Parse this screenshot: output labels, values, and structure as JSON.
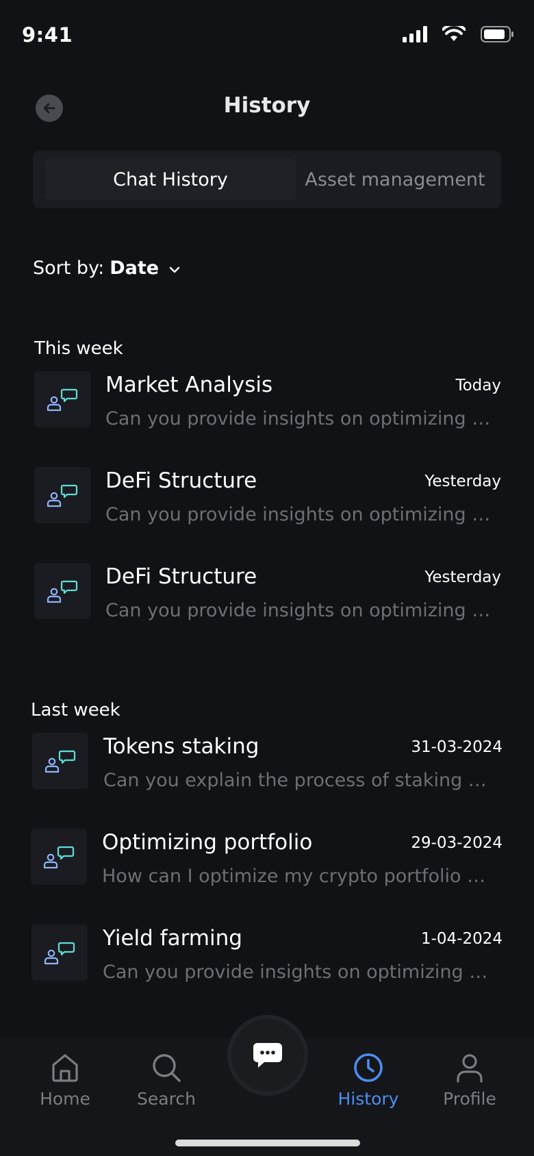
{
  "status_bar": {
    "time": "9:41"
  },
  "header": {
    "title": "History"
  },
  "tabs": [
    {
      "label": "Chat History",
      "active": true
    },
    {
      "label": "Asset management",
      "active": false
    }
  ],
  "sort": {
    "prefix": "Sort by:",
    "value": "Date"
  },
  "sections": [
    {
      "title": "This week",
      "items": [
        {
          "title": "Market Analysis",
          "date": "Today",
          "preview": "Can you provide insights on optimizing my portfolio?"
        },
        {
          "title": "DeFi Structure",
          "date": "Yesterday",
          "preview": "Can you provide insights on optimizing my portfolio?"
        },
        {
          "title": "DeFi Structure",
          "date": "Yesterday",
          "preview": "Can you provide insights on optimizing my portfolio?"
        }
      ]
    },
    {
      "title": "Last week",
      "items": [
        {
          "title": "Tokens staking",
          "date": "31-03-2024",
          "preview": "Can you explain the process of staking my tokens?"
        },
        {
          "title": "Optimizing portfolio",
          "date": "29-03-2024",
          "preview": "How can I optimize my crypto portfolio based on risk?"
        },
        {
          "title": "Yield farming",
          "date": "1-04-2024",
          "preview": "Can you provide insights on optimizing my portfolio?"
        }
      ]
    }
  ],
  "nav": {
    "home": "Home",
    "search": "Search",
    "history": "History",
    "profile": "Profile",
    "active": "history"
  },
  "colors": {
    "background": "#111216",
    "accent": "#4b8ef0",
    "avatar_person": "#8fb4ff",
    "avatar_bubble": "#5ee0d8",
    "muted_text": "#6e6f74"
  },
  "icons": {
    "back": "arrow-left-icon",
    "sort": "chevron-down-icon",
    "chat_avatar": "user-chat-icon",
    "home": "home-icon",
    "search": "search-icon",
    "chat": "chat-bubble-icon",
    "history": "clock-icon",
    "profile": "user-icon"
  }
}
